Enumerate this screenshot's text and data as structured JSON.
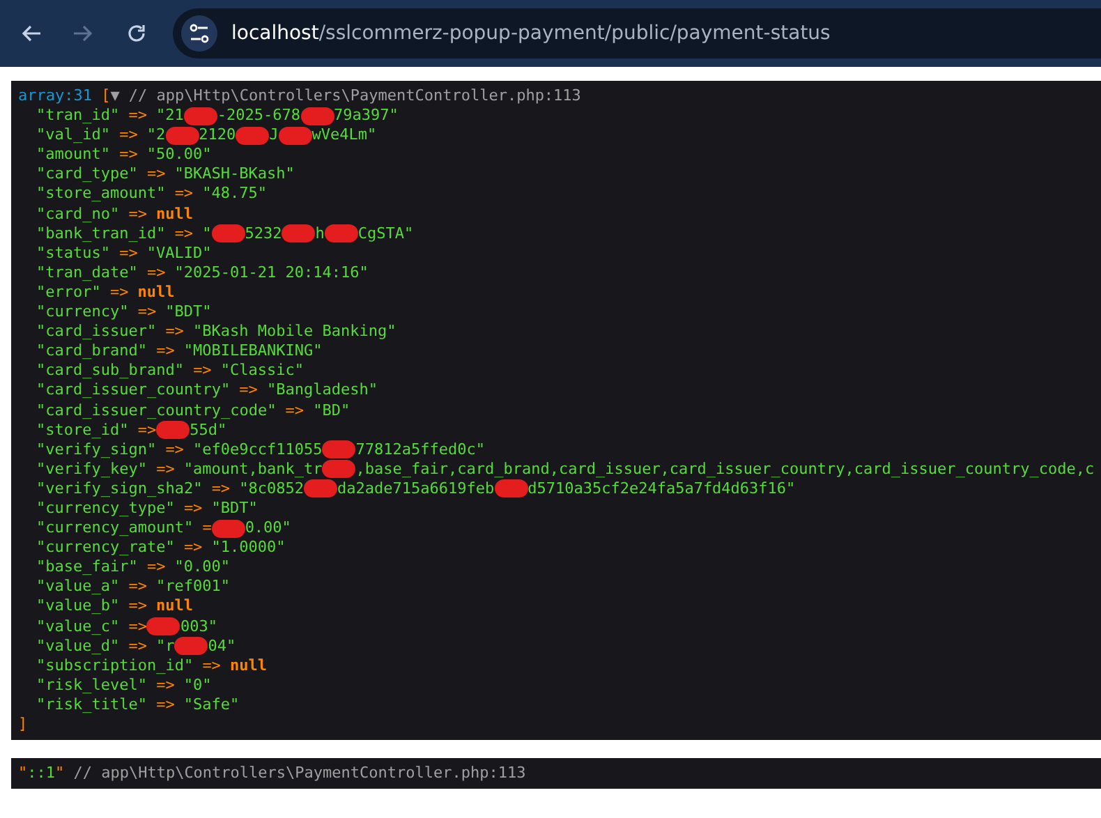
{
  "browser": {
    "buttons": [
      {
        "kind": "back",
        "disabled": false
      },
      {
        "kind": "forward",
        "disabled": true
      },
      {
        "kind": "reload",
        "disabled": false
      }
    ],
    "url_host": "localhost",
    "url_path": "/sslcommerz-popup-payment/public/payment-status"
  },
  "dumps": [
    {
      "header": [
        {
          "kind": "note",
          "text": "array:31"
        },
        {
          "kind": "bracket",
          "text": "["
        },
        {
          "kind": "toggle",
          "text": "▼"
        },
        {
          "kind": "source",
          "text": "// app\\Http\\Controllers\\PaymentController.php:113"
        }
      ],
      "rows": [
        {
          "segments": [
            {
              "kind": "key",
              "text": "\"tran_id\""
            },
            {
              "kind": "arrow",
              "text": "=>"
            },
            {
              "kind": "string",
              "text": "\"21"
            },
            {
              "kind": "redaction"
            },
            {
              "kind": "string",
              "text": "-2025-678"
            },
            {
              "kind": "redaction"
            },
            {
              "kind": "string",
              "text": "79a397\""
            }
          ]
        },
        {
          "segments": [
            {
              "kind": "key",
              "text": "\"val_id\""
            },
            {
              "kind": "arrow",
              "text": "=>"
            },
            {
              "kind": "string",
              "text": "\"2"
            },
            {
              "kind": "redaction"
            },
            {
              "kind": "string",
              "text": "2120"
            },
            {
              "kind": "redaction"
            },
            {
              "kind": "string",
              "text": "J"
            },
            {
              "kind": "redaction"
            },
            {
              "kind": "string",
              "text": "wVe4Lm\""
            }
          ]
        },
        {
          "segments": [
            {
              "kind": "key",
              "text": "\"amount\""
            },
            {
              "kind": "arrow",
              "text": "=>"
            },
            {
              "kind": "string",
              "text": "\"50.00\""
            }
          ]
        },
        {
          "segments": [
            {
              "kind": "key",
              "text": "\"card_type\""
            },
            {
              "kind": "arrow",
              "text": "=>"
            },
            {
              "kind": "string",
              "text": "\"BKASH-BKash\""
            }
          ]
        },
        {
          "segments": [
            {
              "kind": "key",
              "text": "\"store_amount\""
            },
            {
              "kind": "arrow",
              "text": "=>"
            },
            {
              "kind": "string",
              "text": "\"48.75\""
            }
          ]
        },
        {
          "segments": [
            {
              "kind": "key",
              "text": "\"card_no\""
            },
            {
              "kind": "arrow",
              "text": "=>"
            },
            {
              "kind": "null",
              "text": "null"
            }
          ]
        },
        {
          "segments": [
            {
              "kind": "key",
              "text": "\"bank_tran_id\""
            },
            {
              "kind": "arrow",
              "text": "=>"
            },
            {
              "kind": "string",
              "text": "\""
            },
            {
              "kind": "redaction"
            },
            {
              "kind": "string",
              "text": "5232"
            },
            {
              "kind": "redaction"
            },
            {
              "kind": "string",
              "text": "h"
            },
            {
              "kind": "redaction"
            },
            {
              "kind": "string",
              "text": "CgSTA\""
            }
          ]
        },
        {
          "segments": [
            {
              "kind": "key",
              "text": "\"status\""
            },
            {
              "kind": "arrow",
              "text": "=>"
            },
            {
              "kind": "string",
              "text": "\"VALID\""
            }
          ]
        },
        {
          "segments": [
            {
              "kind": "key",
              "text": "\"tran_date\""
            },
            {
              "kind": "arrow",
              "text": "=>"
            },
            {
              "kind": "string",
              "text": "\"2025-01-21 20:14:16\""
            }
          ]
        },
        {
          "segments": [
            {
              "kind": "key",
              "text": "\"error\""
            },
            {
              "kind": "arrow",
              "text": "=>"
            },
            {
              "kind": "null",
              "text": "null"
            }
          ]
        },
        {
          "segments": [
            {
              "kind": "key",
              "text": "\"currency\""
            },
            {
              "kind": "arrow",
              "text": "=>"
            },
            {
              "kind": "string",
              "text": "\"BDT\""
            }
          ]
        },
        {
          "segments": [
            {
              "kind": "key",
              "text": "\"card_issuer\""
            },
            {
              "kind": "arrow",
              "text": "=>"
            },
            {
              "kind": "string",
              "text": "\"BKash Mobile Banking\""
            }
          ]
        },
        {
          "segments": [
            {
              "kind": "key",
              "text": "\"card_brand\""
            },
            {
              "kind": "arrow",
              "text": "=>"
            },
            {
              "kind": "string",
              "text": "\"MOBILEBANKING\""
            }
          ]
        },
        {
          "segments": [
            {
              "kind": "key",
              "text": "\"card_sub_brand\""
            },
            {
              "kind": "arrow",
              "text": "=>"
            },
            {
              "kind": "string",
              "text": "\"Classic\""
            }
          ]
        },
        {
          "segments": [
            {
              "kind": "key",
              "text": "\"card_issuer_country\""
            },
            {
              "kind": "arrow",
              "text": "=>"
            },
            {
              "kind": "string",
              "text": "\"Bangladesh\""
            }
          ]
        },
        {
          "segments": [
            {
              "kind": "key",
              "text": "\"card_issuer_country_code\""
            },
            {
              "kind": "arrow",
              "text": "=>"
            },
            {
              "kind": "string",
              "text": "\"BD\""
            }
          ]
        },
        {
          "segments": [
            {
              "kind": "key",
              "text": "\"store_id\""
            },
            {
              "kind": "arrow",
              "text": "=>"
            },
            {
              "kind": "redaction"
            },
            {
              "kind": "string",
              "text": "55d\""
            }
          ]
        },
        {
          "segments": [
            {
              "kind": "key",
              "text": "\"verify_sign\""
            },
            {
              "kind": "arrow",
              "text": "=>"
            },
            {
              "kind": "string",
              "text": "\"ef0e9ccf11055"
            },
            {
              "kind": "redaction"
            },
            {
              "kind": "string",
              "text": "77812a5ffed0c\""
            }
          ]
        },
        {
          "segments": [
            {
              "kind": "key",
              "text": "\"verify_key\""
            },
            {
              "kind": "arrow",
              "text": "=>"
            },
            {
              "kind": "string",
              "text": "\"amount,bank_tr"
            },
            {
              "kind": "redaction"
            },
            {
              "kind": "string",
              "text": ",base_fair,card_brand,card_issuer,card_issuer_country,card_issuer_country_code,c"
            }
          ]
        },
        {
          "segments": [
            {
              "kind": "key",
              "text": "\"verify_sign_sha2\""
            },
            {
              "kind": "arrow",
              "text": "=>"
            },
            {
              "kind": "string",
              "text": "\"8c0852"
            },
            {
              "kind": "redaction"
            },
            {
              "kind": "string",
              "text": "da2ade715a6619feb"
            },
            {
              "kind": "redaction"
            },
            {
              "kind": "string",
              "text": "d5710a35cf2e24fa5a7fd4d63f16\""
            }
          ]
        },
        {
          "segments": [
            {
              "kind": "key",
              "text": "\"currency_type\""
            },
            {
              "kind": "arrow",
              "text": "=>"
            },
            {
              "kind": "string",
              "text": "\"BDT\""
            }
          ]
        },
        {
          "segments": [
            {
              "kind": "key",
              "text": "\"currency_amount\""
            },
            {
              "kind": "arrow",
              "text": "="
            },
            {
              "kind": "redaction"
            },
            {
              "kind": "string",
              "text": "0.00\""
            }
          ]
        },
        {
          "segments": [
            {
              "kind": "key",
              "text": "\"currency_rate\""
            },
            {
              "kind": "arrow",
              "text": "=>"
            },
            {
              "kind": "string",
              "text": "\"1.0000\""
            }
          ]
        },
        {
          "segments": [
            {
              "kind": "key",
              "text": "\"base_fair\""
            },
            {
              "kind": "arrow",
              "text": "=>"
            },
            {
              "kind": "string",
              "text": "\"0.00\""
            }
          ]
        },
        {
          "segments": [
            {
              "kind": "key",
              "text": "\"value_a\""
            },
            {
              "kind": "arrow",
              "text": "=>"
            },
            {
              "kind": "string",
              "text": "\"ref001\""
            }
          ]
        },
        {
          "segments": [
            {
              "kind": "key",
              "text": "\"value_b\""
            },
            {
              "kind": "arrow",
              "text": "=>"
            },
            {
              "kind": "null",
              "text": "null"
            }
          ]
        },
        {
          "segments": [
            {
              "kind": "key",
              "text": "\"value_c\""
            },
            {
              "kind": "arrow",
              "text": "=>"
            },
            {
              "kind": "redaction"
            },
            {
              "kind": "string",
              "text": "003\""
            }
          ]
        },
        {
          "segments": [
            {
              "kind": "key",
              "text": "\"value_d\""
            },
            {
              "kind": "arrow",
              "text": "=>"
            },
            {
              "kind": "string",
              "text": "\"r"
            },
            {
              "kind": "redaction"
            },
            {
              "kind": "string",
              "text": "04\""
            }
          ]
        },
        {
          "segments": [
            {
              "kind": "key",
              "text": "\"subscription_id\""
            },
            {
              "kind": "arrow",
              "text": "=>"
            },
            {
              "kind": "null",
              "text": "null"
            }
          ]
        },
        {
          "segments": [
            {
              "kind": "key",
              "text": "\"risk_level\""
            },
            {
              "kind": "arrow",
              "text": "=>"
            },
            {
              "kind": "string",
              "text": "\"0\""
            }
          ]
        },
        {
          "segments": [
            {
              "kind": "key",
              "text": "\"risk_title\""
            },
            {
              "kind": "arrow",
              "text": "=>"
            },
            {
              "kind": "string",
              "text": "\"Safe\""
            }
          ]
        }
      ],
      "close": "]"
    },
    {
      "header": [
        {
          "kind": "quote",
          "text": "\""
        },
        {
          "kind": "scalar",
          "text": "::1"
        },
        {
          "kind": "quote",
          "text": "\""
        },
        {
          "kind": "source",
          "text": "// app\\Http\\Controllers\\PaymentController.php:113"
        }
      ]
    }
  ]
}
